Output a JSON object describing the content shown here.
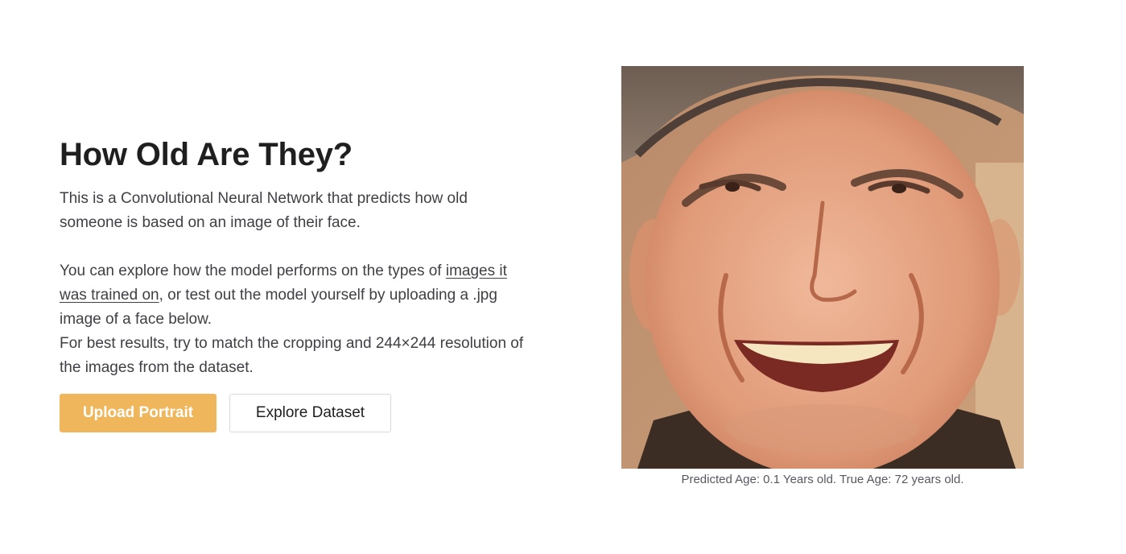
{
  "header": {
    "title": "How Old Are They?"
  },
  "intro": {
    "paragraph1": "This is a Convolutional Neural Network that predicts how old someone is based on an image of their face.",
    "paragraph2_prefix": "You can explore how the model performs on the types of ",
    "paragraph2_link": "images it was trained on",
    "paragraph2_suffix": ", or test out the model yourself by uploading a .jpg image of a face below.",
    "paragraph3": "For best results, try to match the cropping and 244×244 resolution of the images from the dataset."
  },
  "actions": {
    "upload_label": "Upload Portrait",
    "explore_label": "Explore Dataset"
  },
  "result": {
    "caption": "Predicted Age: 0.1 Years old. True Age: 72 years old."
  },
  "colors": {
    "accent": "#f0b65b"
  }
}
